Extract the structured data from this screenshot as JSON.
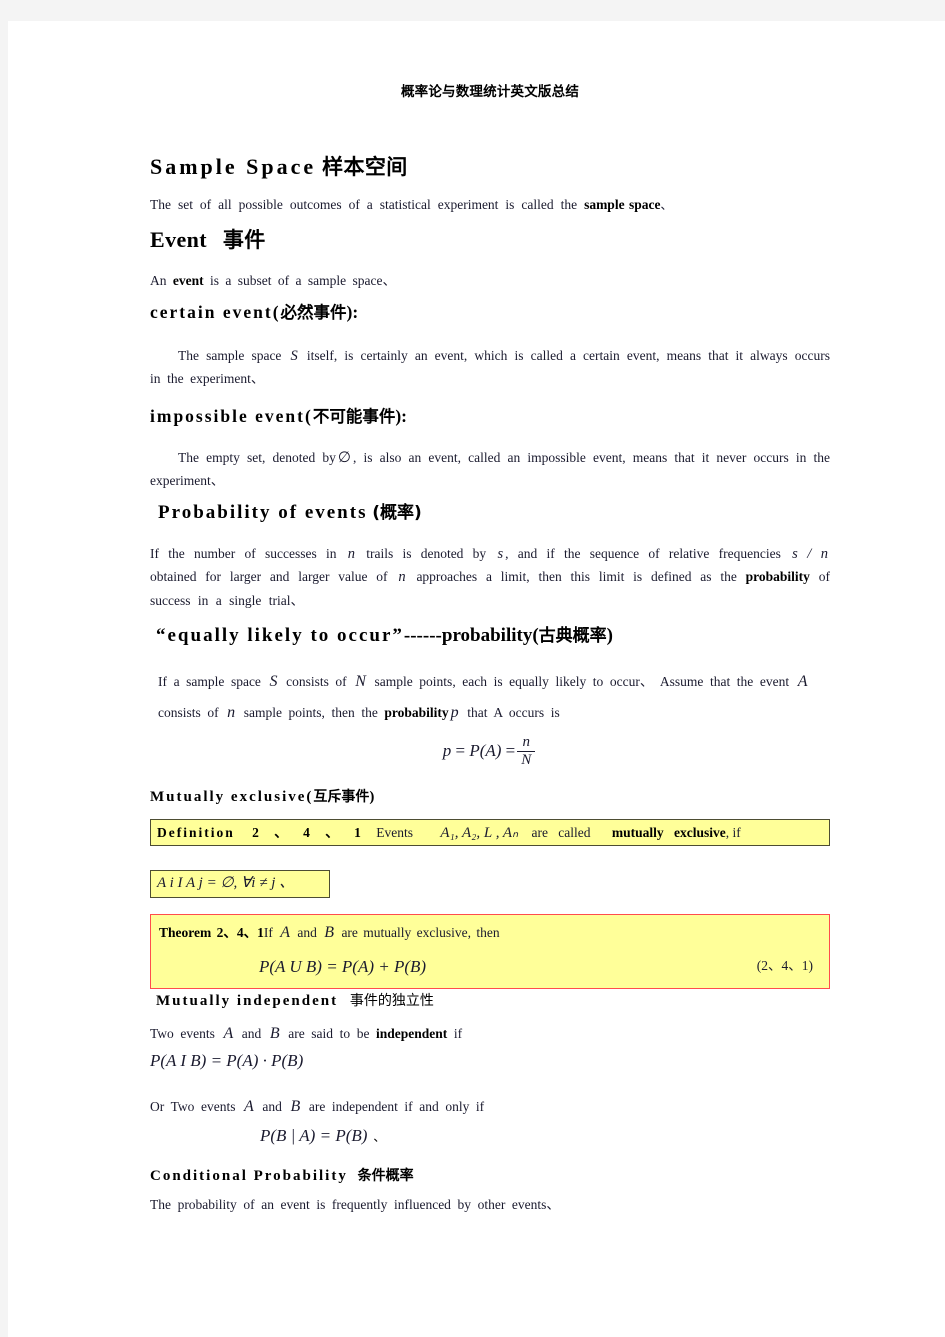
{
  "document": {
    "running_header": "概率论与数理统计英文版总结",
    "page_bg": "#ffffff",
    "canvas_bg": "#f4f4f4",
    "highlight_color": "#ffff99",
    "theorem_border_color": "#ff4d4d",
    "definition_border_color": "#4d4d33"
  },
  "sections": {
    "sample_space": {
      "heading_en": "Sample  Space",
      "heading_cn": "样本空间",
      "body": "The set of all possible outcomes of a statistical experiment is called the ",
      "body_bold": "sample space",
      "body_tail": "、"
    },
    "event": {
      "heading_en": "Event",
      "heading_cn": "事件",
      "body_lead": "An ",
      "body_bold": "event",
      "body_tail": " is a subset of a sample space、"
    },
    "certain_event": {
      "heading_en": "certain  event(",
      "heading_cn": "必然事件",
      "heading_tail": "):",
      "body_1": "The sample space ",
      "body_sym": "S",
      "body_2": " itself, is certainly an event, which is called a certain event, means that it always occurs in the experiment、"
    },
    "impossible_event": {
      "heading_en": "impossible  event(",
      "heading_cn": "不可能事件",
      "heading_tail": "):",
      "body_1": "The empty set, denoted by",
      "body_sym": "∅",
      "body_2": ", is also an event, called an impossible event, means that it never occurs in the experiment、"
    },
    "probability_of_events": {
      "heading_en": "Probability  of  events",
      "heading_cn": "(概率)",
      "body_1": "If the number of successes in ",
      "sym_n": "n",
      "body_2": " trails is denoted by ",
      "sym_s": "s",
      "body_3": ", and if the sequence of relative frequencies ",
      "sym_sn": "s / n",
      "body_4": " obtained for larger and larger value of ",
      "sym_n2": "n",
      "body_5": " approaches a limit, then this limit is defined as the ",
      "bold": "probability",
      "body_6": " of success in a single trial、"
    },
    "equally_likely": {
      "heading_quote": "“equally  likely  to  occur”",
      "heading_dashes": "------",
      "heading_bold": "probability(",
      "heading_cn": "古典概率",
      "heading_tail": ")",
      "body_1": "If a sample space ",
      "sym_S": "S",
      "body_2": " consists of ",
      "sym_N": "N",
      "body_3": " sample points, each is equally likely to occur、 Assume that the event ",
      "sym_A": "A",
      "body_4": " consists of ",
      "sym_n": "n",
      "body_5": " sample points, then the ",
      "bold": "probability",
      "sym_p": "p",
      "body_6": " that   A occurs is",
      "formula": {
        "lhs": "p",
        "eq1": "=",
        "mid": "P(A)",
        "eq2": "=",
        "numerator": "n",
        "denominator": "N"
      }
    },
    "mutually_exclusive": {
      "heading_en": "Mutually  exclusive(",
      "heading_cn": "互斥事件",
      "heading_tail": ")",
      "definition": {
        "label": "Definition",
        "number": "2 、 4 、 1",
        "text_1": "Events",
        "symbols": "A₁, A₂, L , Aₙ",
        "text_2": "are    called",
        "bold": "mutually    exclusive",
        "text_3": ",   if",
        "sub_formula": "A i  I   A j  =  ∅,  ∀i ≠ j 、"
      },
      "theorem": {
        "label": "Theorem",
        "number": "2、4、1",
        "text_1": "If ",
        "sym_A": "A",
        "text_2": " and ",
        "sym_B": "B",
        "text_3": " are mutually exclusive, then",
        "equation": "P(A U B) = P(A) + P(B)",
        "eq_number": "(2、4、1)"
      }
    },
    "mutually_independent": {
      "heading_en": "Mutually  independent",
      "heading_cn": "事件的独立性",
      "line_1a": "Two events ",
      "sym_A": "A",
      "line_1b": " and ",
      "sym_B": "B",
      "line_1c": " are said to be ",
      "bold": "independent",
      "line_1d": " if",
      "formula_1": "P(A I B) = P(A) · P(B)",
      "line_2a": "Or   Two events ",
      "sym_A2": "A",
      "line_2b": " and ",
      "sym_B2": "B",
      "line_2c": " are independent if and only if",
      "formula_2": "P(B | A) = P(B)",
      "formula_2_tail": "、"
    },
    "conditional_probability": {
      "heading_en": "Conditional  Probability",
      "heading_cn": "条件概率",
      "body": "The probability of an event is frequently influenced by other events、"
    }
  }
}
